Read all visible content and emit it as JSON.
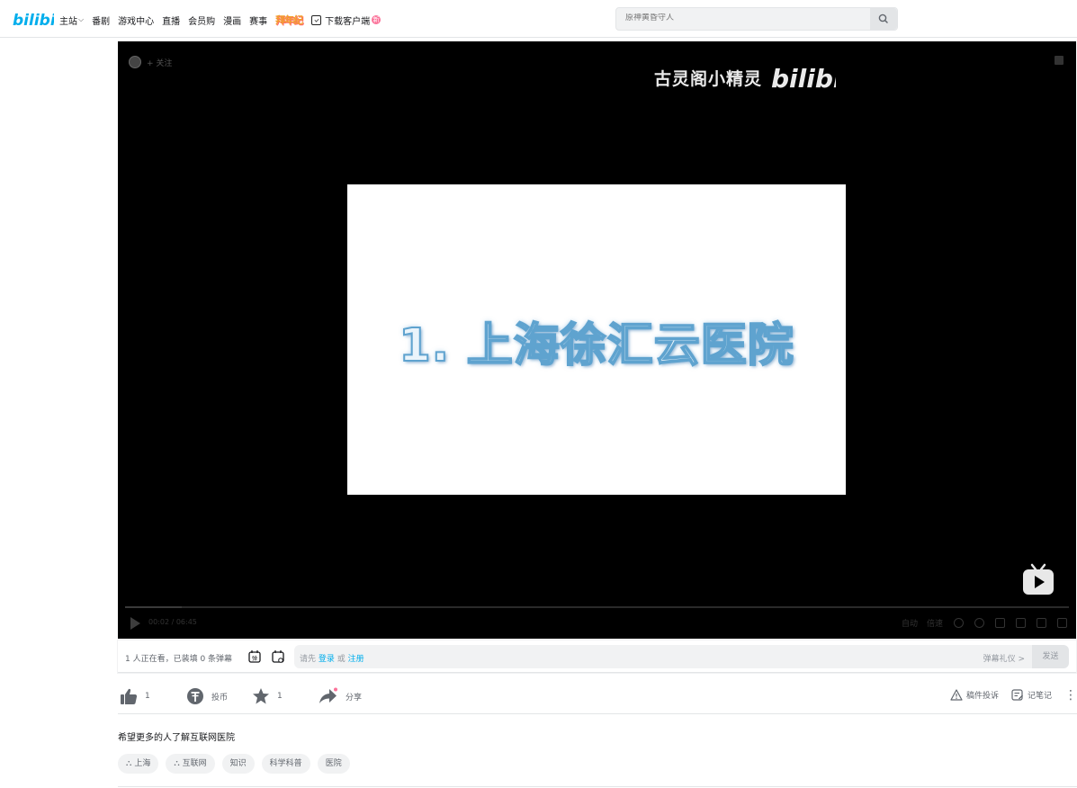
{
  "header": {
    "nav": [
      {
        "label": "主站",
        "has_dropdown": true
      },
      {
        "label": "番剧"
      },
      {
        "label": "游戏中心"
      },
      {
        "label": "直播"
      },
      {
        "label": "会员购"
      },
      {
        "label": "漫画"
      },
      {
        "label": "赛事"
      }
    ],
    "special_label": "拜年纪",
    "download_label": "下载客户端",
    "download_badge": "新",
    "search": {
      "placeholder": "原神黄昏守人"
    }
  },
  "player": {
    "follow_label": "+ 关注",
    "watermark": "古灵阁小精灵",
    "slide_text": "1. 上海徐汇云医院",
    "time": "00:02 / 06:45",
    "progress": 0.06,
    "controls": [
      "自动",
      "倍速"
    ]
  },
  "danmaku": {
    "info": "1 人正在看，已装填 0 条弹幕",
    "prefix": "请先",
    "login": "登录",
    "or": "或",
    "register": "注册",
    "etiquette": "弹幕礼仪 >",
    "send": "发送"
  },
  "toolbar": {
    "like_count": "1",
    "coin_label": "投币",
    "fav_count": "1",
    "share_label": "分享",
    "report_label": "稿件投诉",
    "note_label": "记笔记"
  },
  "description": "希望更多的人了解互联网医院",
  "tags": [
    {
      "label": "上海",
      "topic": true
    },
    {
      "label": "互联网",
      "topic": true
    },
    {
      "label": "知识",
      "topic": false
    },
    {
      "label": "科学科普",
      "topic": false
    },
    {
      "label": "医院",
      "topic": false
    }
  ],
  "colors": {
    "brand": "#00aeec",
    "pink": "#fb7299"
  }
}
